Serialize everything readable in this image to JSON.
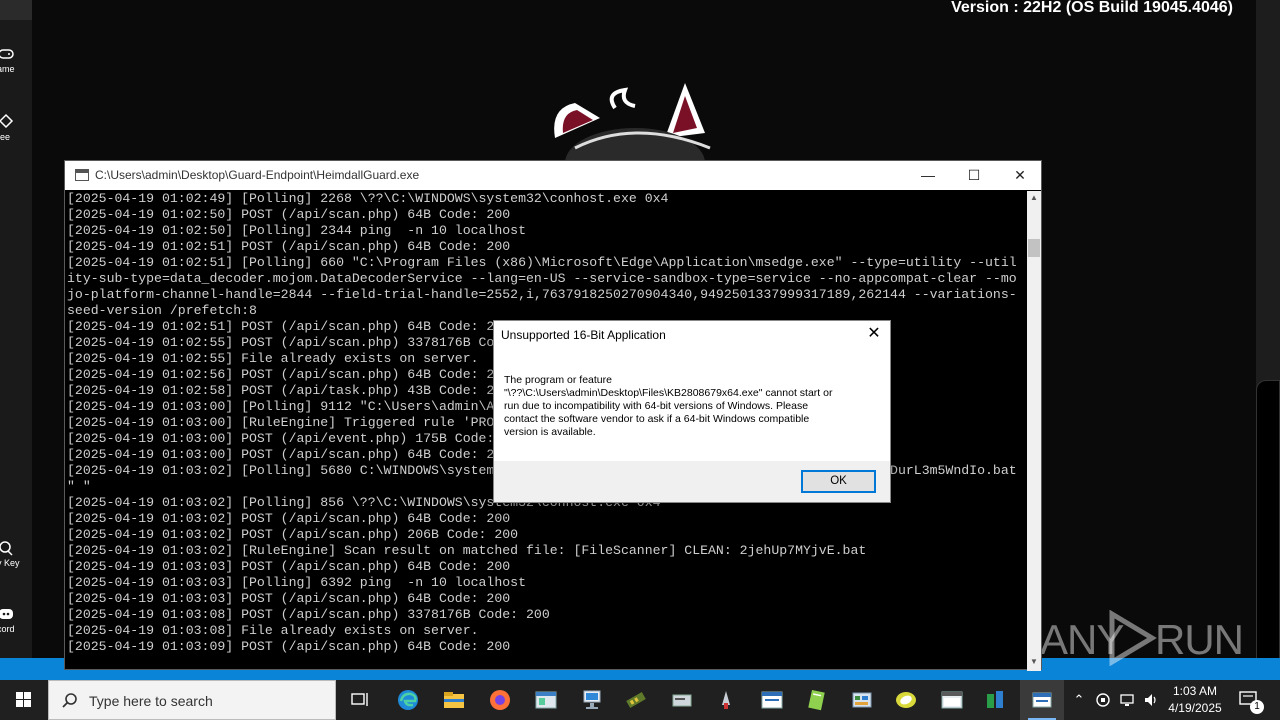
{
  "desktop": {
    "version_text": "Version : 22H2 (OS Build 19045.4046)",
    "left_strip_items": [
      {
        "label": "ame",
        "icon": "gamepad-icon"
      },
      {
        "label": "ree",
        "icon": "gift-icon"
      },
      {
        "label": "y Key",
        "icon": "key-icon"
      },
      {
        "label": "cord",
        "icon": "discord-icon"
      }
    ],
    "watermark": {
      "left": "ANY",
      "right": "RUN"
    }
  },
  "console": {
    "title": "C:\\Users\\admin\\Desktop\\Guard-Endpoint\\HeimdallGuard.exe",
    "lines": [
      "[2025-04-19 01:02:49] [Polling] 2268 \\??\\C:\\WINDOWS\\system32\\conhost.exe 0x4",
      "[2025-04-19 01:02:50] POST (/api/scan.php) 64B Code: 200",
      "[2025-04-19 01:02:50] [Polling] 2344 ping  -n 10 localhost",
      "[2025-04-19 01:02:51] POST (/api/scan.php) 64B Code: 200",
      "[2025-04-19 01:02:51] [Polling] 660 \"C:\\Program Files (x86)\\Microsoft\\Edge\\Application\\msedge.exe\" --type=utility --util",
      "ity-sub-type=data_decoder.mojom.DataDecoderService --lang=en-US --service-sandbox-type=service --no-appcompat-clear --mo",
      "jo-platform-channel-handle=2844 --field-trial-handle=2552,i,7637918250270904340,9492501337999317189,262144 --variations-",
      "seed-version /prefetch:8",
      "[2025-04-19 01:02:51] POST (/api/scan.php) 64B Code: 200",
      "[2025-04-19 01:02:55] POST (/api/scan.php) 3378176B Code: 200",
      "[2025-04-19 01:02:55] File already exists on server.",
      "[2025-04-19 01:02:56] POST (/api/scan.php) 64B Code: 200",
      "[2025-04-19 01:02:58] POST (/api/task.php) 43B Code: 200",
      "[2025-04-19 01:03:00] [Polling] 9112 \"C:\\Users\\admin\\AppData\\Local\\Temp\\",
      "[2025-04-19 01:03:00] [RuleEngine] Triggered rule 'PROCESS_CREATE'",
      "[2025-04-19 01:03:00] POST (/api/event.php) 175B Code: 200",
      "[2025-04-19 01:03:00] POST (/api/scan.php) 64B Code: 200",
      "[2025-04-19 01:03:02] [Polling] 5680 C:\\WINDOWS\\system32\\cmd.exe /c \"\"C:\\Users\\admin\\AppData\\Local\\Temp\\DurL3m5WndIo.bat",
      "\" \"",
      "[2025-04-19 01:03:02] [Polling] 856 \\??\\C:\\WINDOWS\\system32\\conhost.exe 0x4",
      "[2025-04-19 01:03:02] POST (/api/scan.php) 64B Code: 200",
      "[2025-04-19 01:03:02] POST (/api/scan.php) 206B Code: 200",
      "[2025-04-19 01:03:02] [RuleEngine] Scan result on matched file: [FileScanner] CLEAN: 2jehUp7MYjvE.bat",
      "[2025-04-19 01:03:03] POST (/api/scan.php) 64B Code: 200",
      "[2025-04-19 01:03:03] [Polling] 6392 ping  -n 10 localhost",
      "[2025-04-19 01:03:03] POST (/api/scan.php) 64B Code: 200",
      "[2025-04-19 01:03:08] POST (/api/scan.php) 3378176B Code: 200",
      "[2025-04-19 01:03:08] File already exists on server.",
      "[2025-04-19 01:03:09] POST (/api/scan.php) 64B Code: 200"
    ]
  },
  "dialog": {
    "title": "Unsupported 16-Bit Application",
    "close": "✕",
    "message_lines": [
      "The program or feature",
      "\"\\??\\C:\\Users\\admin\\Desktop\\Files\\KB2808679x64.exe\" cannot start or",
      "run due to incompatibility with 64-bit versions of Windows. Please",
      "contact the software vendor to ask if a 64-bit Windows compatible",
      "version is available."
    ],
    "ok_label": "OK"
  },
  "taskbar": {
    "search_placeholder": "Type here to search",
    "pinned": [
      "task-view-icon",
      "edge-icon",
      "file-explorer-icon",
      "firefox-icon",
      "window-app-icon",
      "network-computer-icon",
      "ram-chip-icon",
      "disk-app-icon",
      "wrench-app-icon",
      "window-app-icon",
      "notepad-icon",
      "control-panel-icon",
      "lens-app-icon",
      "window-app-icon",
      "powershell-icon",
      "console-app-icon"
    ],
    "clock": {
      "time": "1:03 AM",
      "date": "4/19/2025"
    },
    "notification_count": "1",
    "colors": {
      "taskbar": "#202020",
      "accent": "#0078d7"
    }
  }
}
